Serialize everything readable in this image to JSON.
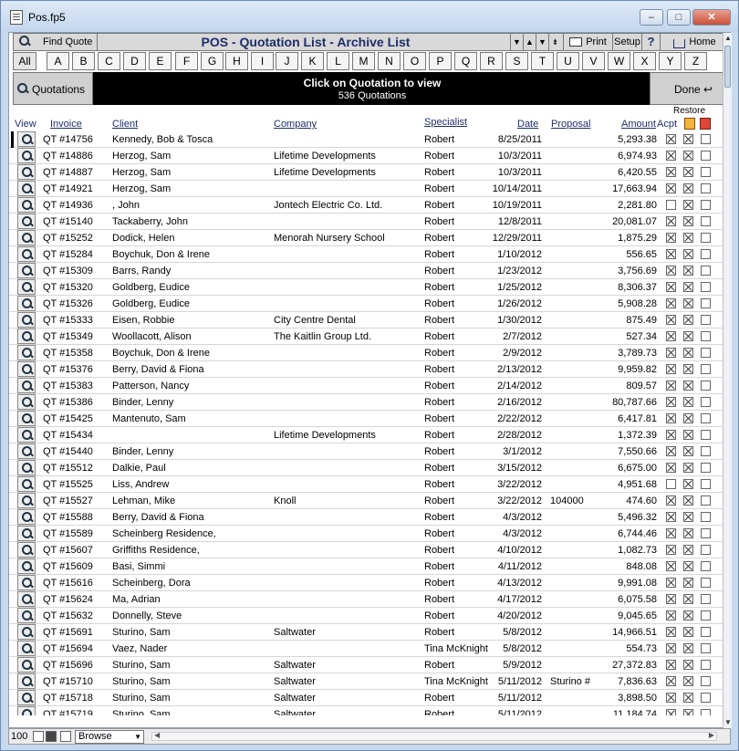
{
  "window": {
    "title": "Pos.fp5"
  },
  "toolbar": {
    "find_label": "Find Quote",
    "title": "POS - Quotation List - Archive List",
    "print_label": "Print",
    "setup_label": "Setup",
    "help_label": "?",
    "home_label": "Home"
  },
  "alpha": [
    "All",
    "A",
    "B",
    "C",
    "D",
    "E",
    "F",
    "G",
    "H",
    "I",
    "J",
    "K",
    "L",
    "M",
    "N",
    "O",
    "P",
    "Q",
    "R",
    "S",
    "T",
    "U",
    "V",
    "W",
    "X",
    "Y",
    "Z"
  ],
  "banner": {
    "left_label": "Quotations",
    "message": "Click on Quotation to view",
    "count": "536 Quotations",
    "right_label": "Done"
  },
  "columns": {
    "restore": "Restore",
    "view": "View",
    "invoice": "Invoice",
    "client": "Client",
    "company": "Company",
    "specialist": "Specialist",
    "date": "Date",
    "proposal": "Proposal",
    "amount": "Amount",
    "accept": "Acpt"
  },
  "rows": [
    {
      "invoice": "QT #14756",
      "client": "Kennedy, Bob & Tosca",
      "company": "",
      "specialist": "Robert",
      "date": "8/25/2011",
      "proposal": "",
      "amount": "5,293.38",
      "acpt": true,
      "restore": true
    },
    {
      "invoice": "QT #14886",
      "client": "Herzog, Sam",
      "company": "Lifetime Developments",
      "specialist": "Robert",
      "date": "10/3/2011",
      "proposal": "",
      "amount": "6,974.93",
      "acpt": true,
      "restore": true
    },
    {
      "invoice": "QT #14887",
      "client": "Herzog, Sam",
      "company": "Lifetime Developments",
      "specialist": "Robert",
      "date": "10/3/2011",
      "proposal": "",
      "amount": "6,420.55",
      "acpt": true,
      "restore": true
    },
    {
      "invoice": "QT #14921",
      "client": "Herzog, Sam",
      "company": "",
      "specialist": "Robert",
      "date": "10/14/2011",
      "proposal": "",
      "amount": "17,663.94",
      "acpt": true,
      "restore": true
    },
    {
      "invoice": "QT #14936",
      "client": ", John",
      "company": "Jontech Electric Co. Ltd.",
      "specialist": "Robert",
      "date": "10/19/2011",
      "proposal": "",
      "amount": "2,281.80",
      "acpt": false,
      "restore": true
    },
    {
      "invoice": "QT #15140",
      "client": "Tackaberry, John",
      "company": "",
      "specialist": "Robert",
      "date": "12/8/2011",
      "proposal": "",
      "amount": "20,081.07",
      "acpt": true,
      "restore": true
    },
    {
      "invoice": "QT #15252",
      "client": "Dodick, Helen",
      "company": "Menorah Nursery School",
      "specialist": "Robert",
      "date": "12/29/2011",
      "proposal": "",
      "amount": "1,875.29",
      "acpt": true,
      "restore": true
    },
    {
      "invoice": "QT #15284",
      "client": "Boychuk, Don & Irene",
      "company": "",
      "specialist": "Robert",
      "date": "1/10/2012",
      "proposal": "",
      "amount": "556.65",
      "acpt": true,
      "restore": true
    },
    {
      "invoice": "QT #15309",
      "client": "Barrs, Randy",
      "company": "",
      "specialist": "Robert",
      "date": "1/23/2012",
      "proposal": "",
      "amount": "3,756.69",
      "acpt": true,
      "restore": true
    },
    {
      "invoice": "QT #15320",
      "client": "Goldberg, Eudice",
      "company": "",
      "specialist": "Robert",
      "date": "1/25/2012",
      "proposal": "",
      "amount": "8,306.37",
      "acpt": true,
      "restore": true
    },
    {
      "invoice": "QT #15326",
      "client": "Goldberg, Eudice",
      "company": "",
      "specialist": "Robert",
      "date": "1/26/2012",
      "proposal": "",
      "amount": "5,908.28",
      "acpt": true,
      "restore": true
    },
    {
      "invoice": "QT #15333",
      "client": "Eisen, Robbie",
      "company": "City Centre Dental",
      "specialist": "Robert",
      "date": "1/30/2012",
      "proposal": "",
      "amount": "875.49",
      "acpt": true,
      "restore": true
    },
    {
      "invoice": "QT #15349",
      "client": "Woollacott, Alison",
      "company": "The Kaitlin Group Ltd.",
      "specialist": "Robert",
      "date": "2/7/2012",
      "proposal": "",
      "amount": "527.34",
      "acpt": true,
      "restore": true
    },
    {
      "invoice": "QT #15358",
      "client": "Boychuk, Don & Irene",
      "company": "",
      "specialist": "Robert",
      "date": "2/9/2012",
      "proposal": "",
      "amount": "3,789.73",
      "acpt": true,
      "restore": true
    },
    {
      "invoice": "QT #15376",
      "client": "Berry, David & Fiona",
      "company": "",
      "specialist": "Robert",
      "date": "2/13/2012",
      "proposal": "",
      "amount": "9,959.82",
      "acpt": true,
      "restore": true
    },
    {
      "invoice": "QT #15383",
      "client": "Patterson, Nancy",
      "company": "",
      "specialist": "Robert",
      "date": "2/14/2012",
      "proposal": "",
      "amount": "809.57",
      "acpt": true,
      "restore": true
    },
    {
      "invoice": "QT #15386",
      "client": "Binder, Lenny",
      "company": "",
      "specialist": "Robert",
      "date": "2/16/2012",
      "proposal": "",
      "amount": "80,787.66",
      "acpt": true,
      "restore": true
    },
    {
      "invoice": "QT #15425",
      "client": "Mantenuto, Sam",
      "company": "",
      "specialist": "Robert",
      "date": "2/22/2012",
      "proposal": "",
      "amount": "6,417.81",
      "acpt": true,
      "restore": true
    },
    {
      "invoice": "QT #15434",
      "client": "",
      "company": "Lifetime Developments",
      "specialist": "Robert",
      "date": "2/28/2012",
      "proposal": "",
      "amount": "1,372.39",
      "acpt": true,
      "restore": true
    },
    {
      "invoice": "QT #15440",
      "client": "Binder, Lenny",
      "company": "",
      "specialist": "Robert",
      "date": "3/1/2012",
      "proposal": "",
      "amount": "7,550.66",
      "acpt": true,
      "restore": true
    },
    {
      "invoice": "QT #15512",
      "client": "Dalkie, Paul",
      "company": "",
      "specialist": "Robert",
      "date": "3/15/2012",
      "proposal": "",
      "amount": "6,675.00",
      "acpt": true,
      "restore": true
    },
    {
      "invoice": "QT #15525",
      "client": "Liss, Andrew",
      "company": "",
      "specialist": "Robert",
      "date": "3/22/2012",
      "proposal": "",
      "amount": "4,951.68",
      "acpt": false,
      "restore": true
    },
    {
      "invoice": "QT #15527",
      "client": "Lehman, Mike",
      "company": "Knoll",
      "specialist": "Robert",
      "date": "3/22/2012",
      "proposal": "104000",
      "amount": "474.60",
      "acpt": true,
      "restore": true
    },
    {
      "invoice": "QT #15588",
      "client": "Berry, David & Fiona",
      "company": "",
      "specialist": "Robert",
      "date": "4/3/2012",
      "proposal": "",
      "amount": "5,496.32",
      "acpt": true,
      "restore": true
    },
    {
      "invoice": "QT #15589",
      "client": "Scheinberg Residence,",
      "company": "",
      "specialist": "Robert",
      "date": "4/3/2012",
      "proposal": "",
      "amount": "6,744.46",
      "acpt": true,
      "restore": true
    },
    {
      "invoice": "QT #15607",
      "client": "Griffiths Residence,",
      "company": "",
      "specialist": "Robert",
      "date": "4/10/2012",
      "proposal": "",
      "amount": "1,082.73",
      "acpt": true,
      "restore": true
    },
    {
      "invoice": "QT #15609",
      "client": "Basi, Simmi",
      "company": "",
      "specialist": "Robert",
      "date": "4/11/2012",
      "proposal": "",
      "amount": "848.08",
      "acpt": true,
      "restore": true
    },
    {
      "invoice": "QT #15616",
      "client": "Scheinberg, Dora",
      "company": "",
      "specialist": "Robert",
      "date": "4/13/2012",
      "proposal": "",
      "amount": "9,991.08",
      "acpt": true,
      "restore": true
    },
    {
      "invoice": "QT #15624",
      "client": "Ma, Adrian",
      "company": "",
      "specialist": "Robert",
      "date": "4/17/2012",
      "proposal": "",
      "amount": "6,075.58",
      "acpt": true,
      "restore": true
    },
    {
      "invoice": "QT #15632",
      "client": "Donnelly, Steve",
      "company": "",
      "specialist": "Robert",
      "date": "4/20/2012",
      "proposal": "",
      "amount": "9,045.65",
      "acpt": true,
      "restore": true
    },
    {
      "invoice": "QT #15691",
      "client": "Sturino, Sam",
      "company": "Saltwater",
      "specialist": "Robert",
      "date": "5/8/2012",
      "proposal": "",
      "amount": "14,966.51",
      "acpt": true,
      "restore": true
    },
    {
      "invoice": "QT #15694",
      "client": "Vaez, Nader",
      "company": "",
      "specialist": "Tina McKnight",
      "date": "5/8/2012",
      "proposal": "",
      "amount": "554.73",
      "acpt": true,
      "restore": true
    },
    {
      "invoice": "QT #15696",
      "client": "Sturino, Sam",
      "company": "Saltwater",
      "specialist": "Robert",
      "date": "5/9/2012",
      "proposal": "",
      "amount": "27,372.83",
      "acpt": true,
      "restore": true
    },
    {
      "invoice": "QT #15710",
      "client": "Sturino, Sam",
      "company": "Saltwater",
      "specialist": "Tina McKnight",
      "date": "5/11/2012",
      "proposal": "Sturino #",
      "amount": "7,836.63",
      "acpt": true,
      "restore": true
    },
    {
      "invoice": "QT #15718",
      "client": "Sturino, Sam",
      "company": "Saltwater",
      "specialist": "Robert",
      "date": "5/11/2012",
      "proposal": "",
      "amount": "3,898.50",
      "acpt": true,
      "restore": true
    },
    {
      "invoice": "QT #15719",
      "client": "Sturino, Sam",
      "company": "Saltwater",
      "specialist": "Robert",
      "date": "5/11/2012",
      "proposal": "",
      "amount": "11,184.74",
      "acpt": true,
      "restore": true
    }
  ],
  "status": {
    "zoom": "100",
    "mode": "Browse"
  }
}
